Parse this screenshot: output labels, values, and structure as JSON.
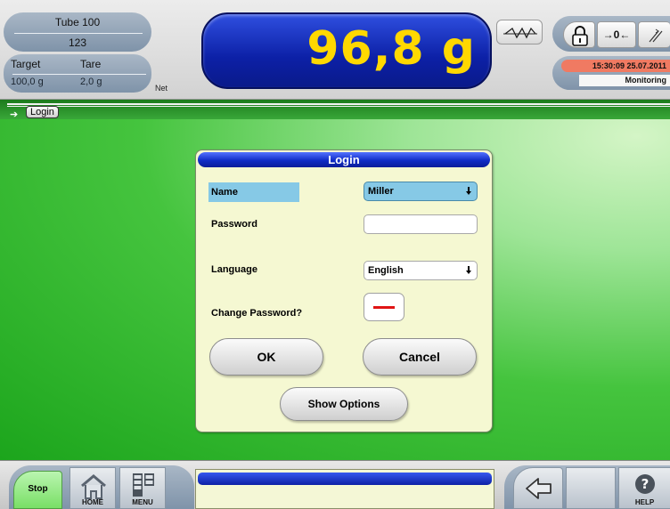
{
  "header": {
    "product_name": "Tube 100",
    "product_code": "123",
    "target_label": "Target",
    "target_value": "100,0 g",
    "tare_label": "Tare",
    "tare_value": "2,0 g",
    "net_label": "Net",
    "weight": "96,8 g",
    "zero_label": "→0←",
    "datetime": "15:30:09  25.07.2011",
    "status": "Monitoring"
  },
  "breadcrumb": {
    "current": "Login"
  },
  "dialog": {
    "title": "Login",
    "name_label": "Name",
    "name_value": "Miller",
    "password_label": "Password",
    "password_value": "",
    "language_label": "Language",
    "language_value": "English",
    "change_password_label": "Change Password?",
    "ok_label": "OK",
    "cancel_label": "Cancel",
    "options_label": "Show Options"
  },
  "footer": {
    "stop_label": "Stop",
    "home_label": "HOME",
    "menu_label": "MENU",
    "help_label": "HELP"
  },
  "colors": {
    "weight_text": "#ffd800",
    "display_blue": "#0c20a6",
    "dialog_bg": "#f5f8d2",
    "name_highlight": "#86c9e6",
    "datetime_bg": "#f07a62",
    "stop_green": "#79df66"
  }
}
